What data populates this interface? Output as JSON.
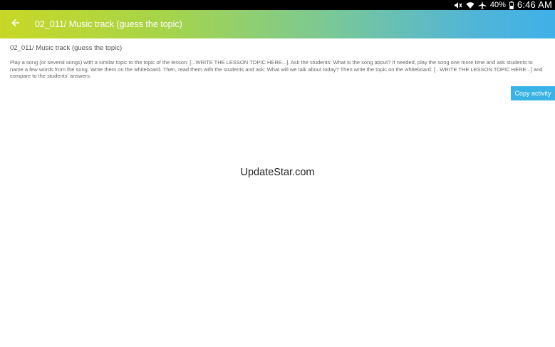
{
  "status_bar": {
    "battery_percent": "40%",
    "time": "6:46 AM",
    "icons": [
      "mute-icon",
      "wifi-icon",
      "airplane-mode-icon",
      "battery-icon"
    ]
  },
  "app_bar": {
    "title": "02_011/ Music track (guess the topic)",
    "back_icon": "arrow-left-icon",
    "gradient_colors": [
      "#c7d826",
      "#79c898",
      "#3fb0e8"
    ]
  },
  "activity": {
    "title": "02_011/ Music track (guess the topic)",
    "description": "Play a song (or several songs) with a similar topic to the topic of the lesson: [...WRITE THE LESSON TOPIC HERE...]. Ask the students: What is the song about? If needed, play the song one more time and ask students to name a few words from the song. Write them on the whiteboard. Then, read them with the students and ask: What will we talk about today? Then write the topic on the whiteboard: [...WRITE THE LESSON TOPIC HERE...] and compare to the students' answers."
  },
  "copy_button": {
    "label": "Copy activity",
    "color": "#39b3e6"
  },
  "watermark": "UpdateStar.com"
}
